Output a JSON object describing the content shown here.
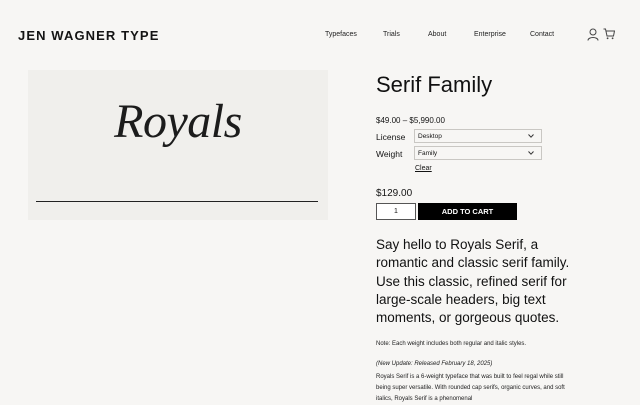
{
  "header": {
    "logo": "JEN WAGNER TYPE",
    "nav": [
      "Typefaces",
      "Trials",
      "About",
      "Enterprise",
      "Contact"
    ],
    "icons": [
      "user-icon",
      "cart-icon"
    ]
  },
  "preview": {
    "specimen_text": "Royals"
  },
  "product": {
    "title": "Serif Family",
    "price_range": "$49.00 – $5,990.00",
    "license_label": "License",
    "license_value": "Desktop",
    "weight_label": "Weight",
    "weight_value": "Family",
    "clear_label": "Clear",
    "price": "$129.00",
    "quantity": "1",
    "add_to_cart": "ADD TO CART",
    "description": "Say hello to Royals Serif, a romantic and classic serif family. Use this classic, refined serif for large-scale headers, big text moments, or gorgeous quotes.",
    "note": "Note: Each weight includes both regular and italic styles.",
    "update": "(New Update: Released February 18, 2025)",
    "body": "Royals Serif is a 6-weight typeface that was built to feel regal while still being super versatile. With rounded cap serifs, organic curves, and soft italics, Royals Serif is a phenomenal"
  },
  "colors": {
    "background": "#f7f6f4",
    "preview_background": "#f0efec",
    "button": "#000000",
    "text": "#141414"
  }
}
